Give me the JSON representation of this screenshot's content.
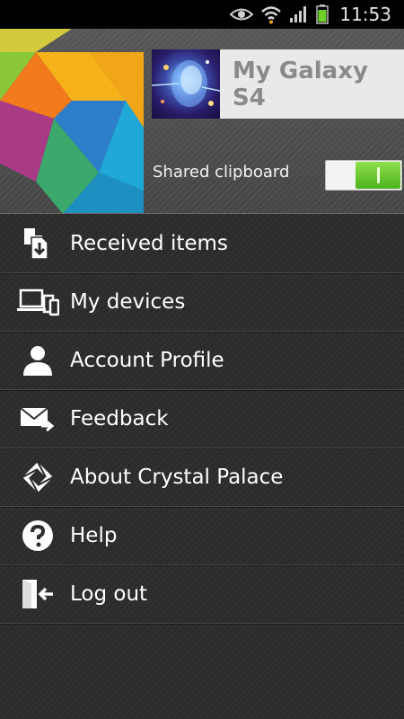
{
  "status_bar": {
    "time": "11:53",
    "icons": [
      "eye-icon",
      "wifi-icon",
      "signal-icon",
      "battery-icon"
    ]
  },
  "header": {
    "device_name": "My Galaxy S4",
    "shared_clipboard_label": "Shared clipboard",
    "shared_clipboard_on": true,
    "toggle_accent": "#5cc226"
  },
  "menu": {
    "items": [
      {
        "label": "Received items",
        "icon": "received-items-icon"
      },
      {
        "label": "My devices",
        "icon": "devices-icon"
      },
      {
        "label": "Account Profile",
        "icon": "person-icon"
      },
      {
        "label": "Feedback",
        "icon": "mail-forward-icon"
      },
      {
        "label": "About Crystal Palace",
        "icon": "crystal-palace-logo-icon"
      },
      {
        "label": "Help",
        "icon": "help-icon"
      },
      {
        "label": "Log out",
        "icon": "logout-icon"
      }
    ]
  }
}
